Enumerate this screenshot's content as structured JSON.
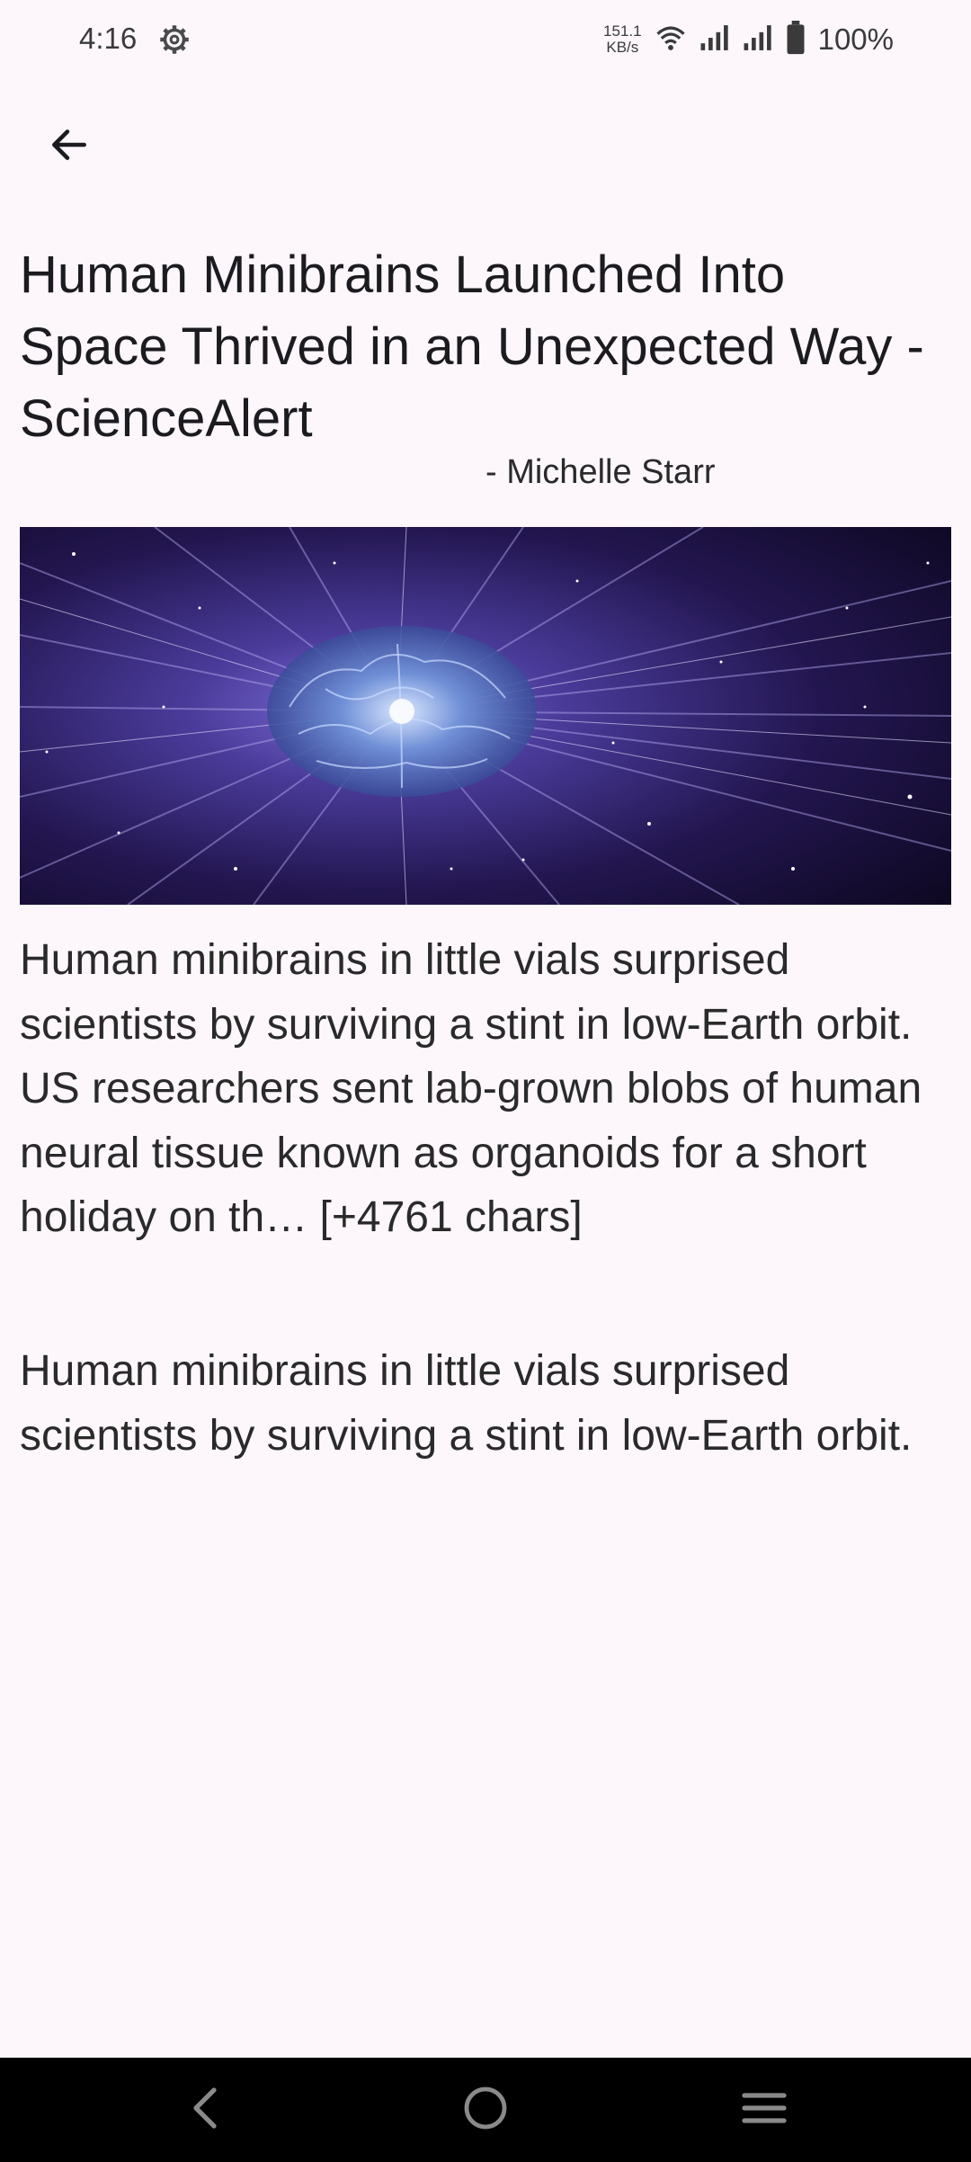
{
  "status_bar": {
    "time": "4:16",
    "net_speed_value": "151.1",
    "net_speed_unit": "KB/s",
    "battery": "100%",
    "icons": [
      "settings-gear-icon",
      "wifi-icon",
      "signal-icon",
      "signal-icon",
      "battery-icon"
    ]
  },
  "header": {
    "back_icon": "arrow-back-icon"
  },
  "article": {
    "title": "Human Minibrains Launched Into Space Thrived in an Unexpected Way - ScienceAlert",
    "author": "- Michelle Starr",
    "content": "Human minibrains in little vials surprised scientists by surviving a stint in low-Earth orbit.\nUS researchers sent lab-grown blobs of human neural tissue known as organoids for a short holiday on th… [+4761 chars]",
    "description": "Human minibrains in little vials surprised scientists by surviving a stint in low-Earth orbit."
  },
  "nav_bar": {
    "icons": [
      "nav-back-icon",
      "home-icon",
      "recents-menu-icon"
    ]
  }
}
